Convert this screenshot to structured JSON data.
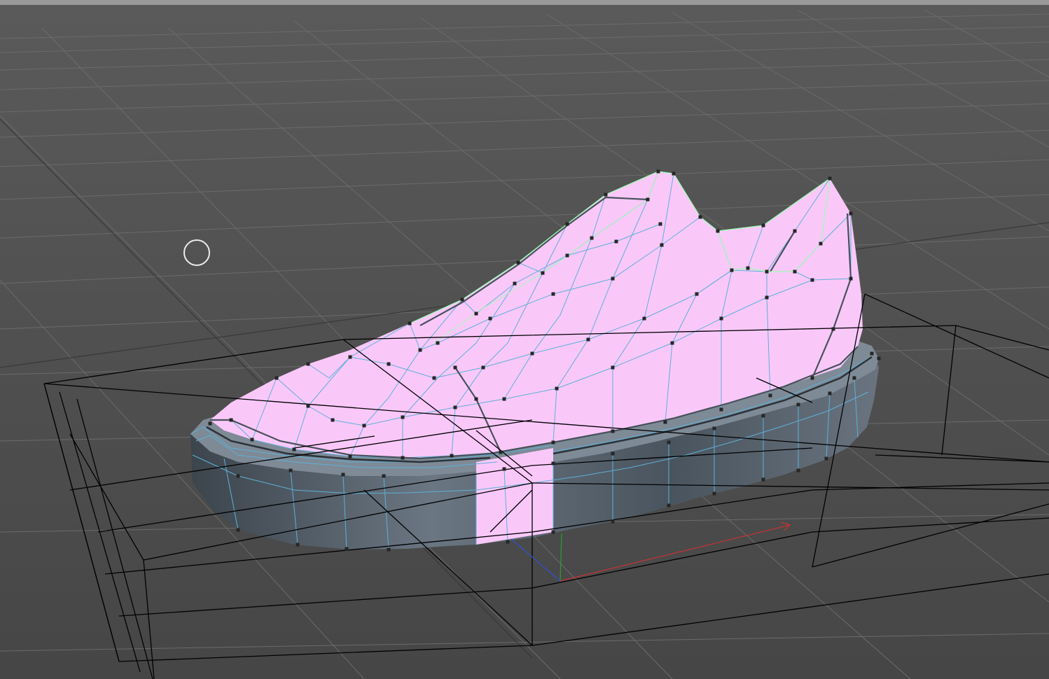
{
  "viewport": {
    "background_top": "#5a5a5a",
    "background_bottom": "#464646",
    "top_bar_color": "#9a9a9a",
    "grid_color": "#6b6b6b",
    "grid_dark_color": "#3a3a3a",
    "cage_color": "#000000"
  },
  "model": {
    "selected_face_color": "#f9c8f9",
    "unselected_face_color": "#48525c",
    "edge_color": "#5eb0d8",
    "vertex_color": "#262626",
    "silhouette_color": "#9affb0"
  },
  "axes": {
    "x_color": "#c83232",
    "y_color": "#2aa02a",
    "z_color": "#3050d0"
  },
  "cursor": {
    "icon": "brush-circle-icon",
    "color": "#ececec"
  }
}
